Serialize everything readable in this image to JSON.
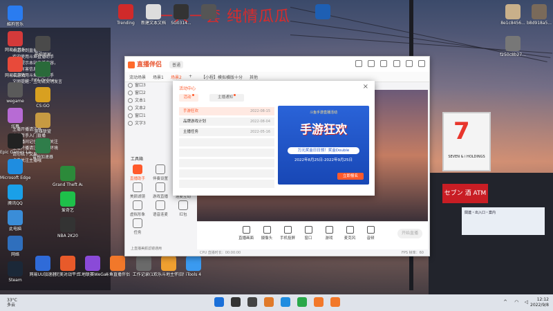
{
  "overlay_title": "一人一套 纯情瓜瓜",
  "desktop_left": [
    {
      "label": "酷狗音乐",
      "color": "#2a7cf0"
    },
    {
      "label": "网易云音乐",
      "color": "#d43a3a"
    },
    {
      "label": "网易云游戏",
      "color": "#e84a3a"
    },
    {
      "label": "wegame",
      "color": "#5a5a5a"
    },
    {
      "label": "炫舞",
      "color": "#b76bd4"
    },
    {
      "label": "Epic Games Launcher",
      "color": "#222"
    },
    {
      "label": "Microsoft Edge",
      "color": "#1f8de0"
    },
    {
      "label": "腾讯QQ",
      "color": "#1aa0e8"
    },
    {
      "label": "此电脑",
      "color": "#3a8dd8"
    },
    {
      "label": "网络",
      "color": "#2f6fbd"
    },
    {
      "label": "Steam",
      "color": "#1b2838"
    }
  ],
  "desktop_col2": [
    {
      "label": "电脑管家",
      "color": "#4a4a4a"
    },
    {
      "label": "FIFA Online",
      "color": "#2a6a3a"
    },
    {
      "label": "CS:GO",
      "color": "#d8a020"
    },
    {
      "label": "英雄联盟",
      "color": "#c79a42"
    },
    {
      "label": "雷神加速器",
      "color": "#2f7d4a"
    },
    {
      "label": "Grand Theft Auto V",
      "color": "#2c8a3a"
    },
    {
      "label": "爱奇艺",
      "color": "#1ec04a"
    },
    {
      "label": "NBA 2K20",
      "color": "#333"
    },
    {
      "label": "网易UU加速器",
      "color": "#2f6bd8"
    },
    {
      "label": "完美对战平台",
      "color": "#e85a2a"
    },
    {
      "label": "三地联赛WeGame版",
      "color": "#8a4ad8"
    },
    {
      "label": "斗鱼直播伴侣",
      "color": "#f2782a"
    },
    {
      "label": "工作记录(1)",
      "color": "#6a6a6a"
    },
    {
      "label": "欢乐斗地主怀旧版",
      "color": "#f0a030"
    },
    {
      "label": "iTools 4",
      "color": "#3a9af0"
    }
  ],
  "desktop_top": [
    {
      "label": "Trending",
      "color": "#d02a2a"
    },
    {
      "label": "新建文本文档",
      "color": "#ddd"
    },
    {
      "label": "SG0314...",
      "color": "#333"
    },
    {
      "label": "",
      "color": "#555"
    },
    {
      "label": "",
      "color": "#1e5fb3"
    }
  ],
  "desktop_right": [
    {
      "label": "8e1c8456...",
      "color": "#c9b08a"
    },
    {
      "label": "b8d918a5...",
      "color": "#7a6a5a"
    },
    {
      "label": "f250c8b27...",
      "color": "#777"
    }
  ],
  "chat_lines": [
    "欢迎来到直播间",
    "欢迎使用斗鱼直播助手",
    "友情提示本站直播内容，",
    "在上有害信息",
    "欢迎使用斗鱼直播助手",
    "文明提醒：互动请文明发言",
    "主播开播请注意",
    "欢迎新手入门直播",
    "进直播间记住要点击关注",
    "主播开播请注意播放环境",
    "请勿私下交易",
    "点击关注主播哦"
  ],
  "app": {
    "logo": "直播伴侣",
    "badge": "普通",
    "tabs": [
      "流动场景",
      "场景1",
      "场景2",
      "+",
      "【小程】模拟横版十分",
      "其他"
    ],
    "layers": [
      {
        "name": "窗口3"
      },
      {
        "name": "窗口2"
      },
      {
        "name": "文本1"
      },
      {
        "name": "文本2"
      },
      {
        "name": "窗口1"
      },
      {
        "name": "文字3"
      }
    ],
    "tools_title": "工具箱",
    "tools": [
      {
        "label": "直播助手",
        "red": true
      },
      {
        "label": "伴奏设置",
        "red": false
      },
      {
        "label": "视频连麦",
        "red": false
      },
      {
        "label": "美颜滤镜",
        "red": false
      },
      {
        "label": "游戏直播",
        "red": false
      },
      {
        "label": "连麦互动",
        "red": false
      },
      {
        "label": "虚拟形象",
        "red": false
      },
      {
        "label": "语音连麦",
        "red": false
      },
      {
        "label": "红包",
        "red": false
      },
      {
        "label": "任务",
        "red": false
      }
    ],
    "tools_note": "上直播美颜滤镜通用",
    "bottom_buttons": [
      "直播画面",
      "摄像头",
      "手机投屏",
      "窗口",
      "游戏",
      "麦克风",
      "音频"
    ],
    "start_label": "开始直播",
    "status_left": "CPU 直播时长：00:00:00",
    "status_right": "FPS 帧率：60"
  },
  "dialog": {
    "title": "活动中心",
    "close": "×",
    "tab_active": "活动",
    "tab_other": "主播通知",
    "items": [
      {
        "name": "手游狂欢",
        "date": "2022-08-15",
        "selected": true
      },
      {
        "name": "品牌游戏计划",
        "date": "2022-08-04",
        "selected": false
      },
      {
        "name": "主播任务",
        "date": "2022-05-16",
        "selected": false
      }
    ],
    "banner": {
      "top": "斗鱼手游直播活动",
      "headline": "手游狂欢",
      "pill": "万元奖金日日领！奖金Double",
      "dates": "2022年8月25日-2022年9月25日",
      "cta": "立即报名"
    }
  },
  "sign": {
    "main": "7",
    "sub": "SEVEN & i HOLDINGS",
    "atm": "セブン 酒 ATM",
    "notice": "関連・出入口・案内"
  },
  "taskbar": {
    "temp": "33°C",
    "weather": "多云",
    "time": "12:12",
    "date": "2022/9/8",
    "icons": [
      "#1a6fd8",
      "#333",
      "#444",
      "#e07a2a",
      "#1f8de0",
      "#2aa84a",
      "#f2782a",
      "#f2782a"
    ]
  }
}
